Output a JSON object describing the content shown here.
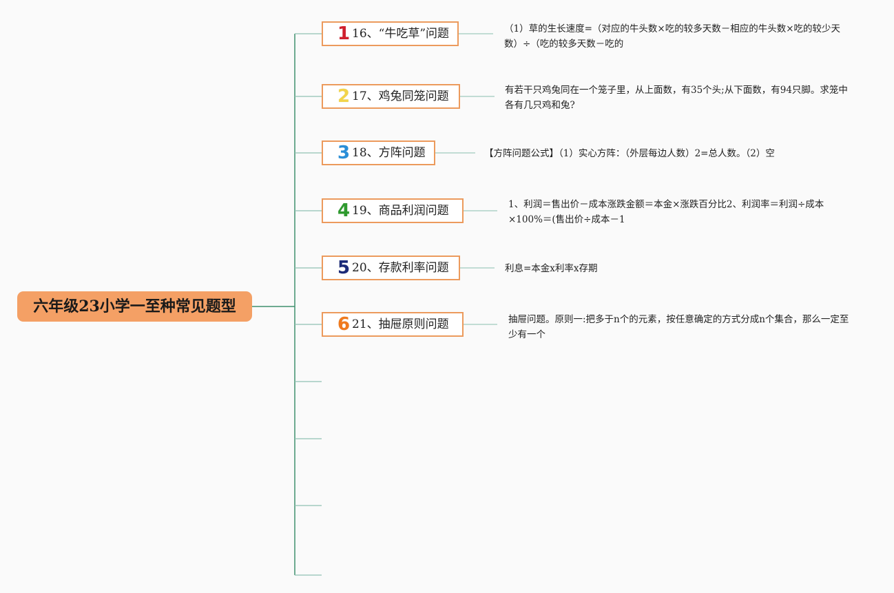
{
  "root": {
    "label": "六年级23小学一至种常见题型"
  },
  "topics": [
    {
      "marker": "1",
      "marker_color": "#d0202e",
      "label": "16、“牛吃草”问题",
      "detail": "（1）草的生长速度=（对应的牛头数×吃的较多天数－相应的牛头数×吃的较少天数）÷（吃的较多天数－吃的"
    },
    {
      "marker": "2",
      "marker_color": "#f2d44a",
      "label": "17、鸡兔同笼问题",
      "detail": "有若干只鸡兔同在一个笼子里，从上面数，有35个头;从下面数，有94只脚。求笼中各有几只鸡和兔?"
    },
    {
      "marker": "3",
      "marker_color": "#2a8fd8",
      "label": "18、方阵问题",
      "detail": "【方阵问题公式】（1）实心方阵：（外层每边人数）2=总人数。（2）空"
    },
    {
      "marker": "4",
      "marker_color": "#2f9a2f",
      "label": "19、商品利润问题",
      "detail": "1、利润＝售出价－成本涨跌金额＝本金×涨跌百分比2、利润率＝利润÷成本×100%＝(售出价÷成本－1"
    },
    {
      "marker": "5",
      "marker_color": "#1b2a78",
      "label": "20、存款利率问题",
      "detail": "利息=本金x利率x存期"
    },
    {
      "marker": "6",
      "marker_color": "#f07a1e",
      "label": "21、抽屉原则问题",
      "detail": "抽屉问题。原则一:把多于n个的元素，按任意确定的方式分成n个集合，那么一定至少有一个"
    }
  ],
  "colors": {
    "trunk_line": "#3e8f6c",
    "branch_line": "#8fc1b2",
    "detail_line": "#9fcbbd",
    "topic_border": "#ec9a5c",
    "root_fill": "#f4a065"
  }
}
